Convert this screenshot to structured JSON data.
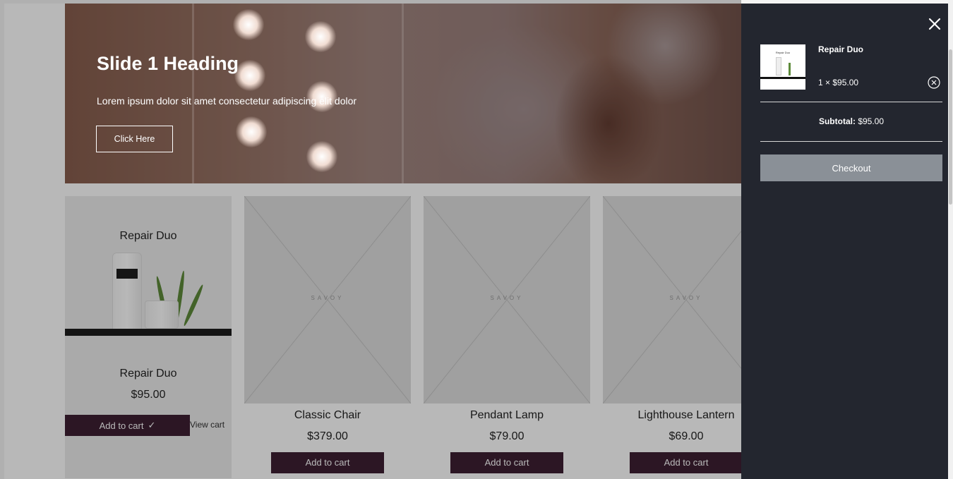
{
  "hero": {
    "heading": "Slide 1 Heading",
    "text": "Lorem ipsum dolor sit amet consectetur adipiscing elit dolor",
    "button_label": "Click Here"
  },
  "featured_product": {
    "image_title": "Repair Duo",
    "name": "Repair Duo",
    "price": "$95.00",
    "added_button_label": "Add to cart",
    "view_cart_label": "View cart"
  },
  "products": [
    {
      "name": "Classic Chair",
      "price": "$379.00",
      "button_label": "Add to cart",
      "placeholder": "SAVOY"
    },
    {
      "name": "Pendant Lamp",
      "price": "$79.00",
      "button_label": "Add to cart",
      "placeholder": "SAVOY"
    },
    {
      "name": "Lighthouse Lantern",
      "price": "$69.00",
      "button_label": "Add to cart",
      "placeholder": "SAVOY"
    }
  ],
  "side_cart": {
    "item": {
      "thumb_title": "Repair Duo",
      "name": "Repair Duo",
      "quantity_price": "1 × $95.00"
    },
    "subtotal_label": "Subtotal:",
    "subtotal_value": "$95.00",
    "checkout_label": "Checkout"
  },
  "colors": {
    "button": "#3d1f33",
    "side_cart_bg": "#23262f",
    "checkout_bg": "#8a9097"
  }
}
